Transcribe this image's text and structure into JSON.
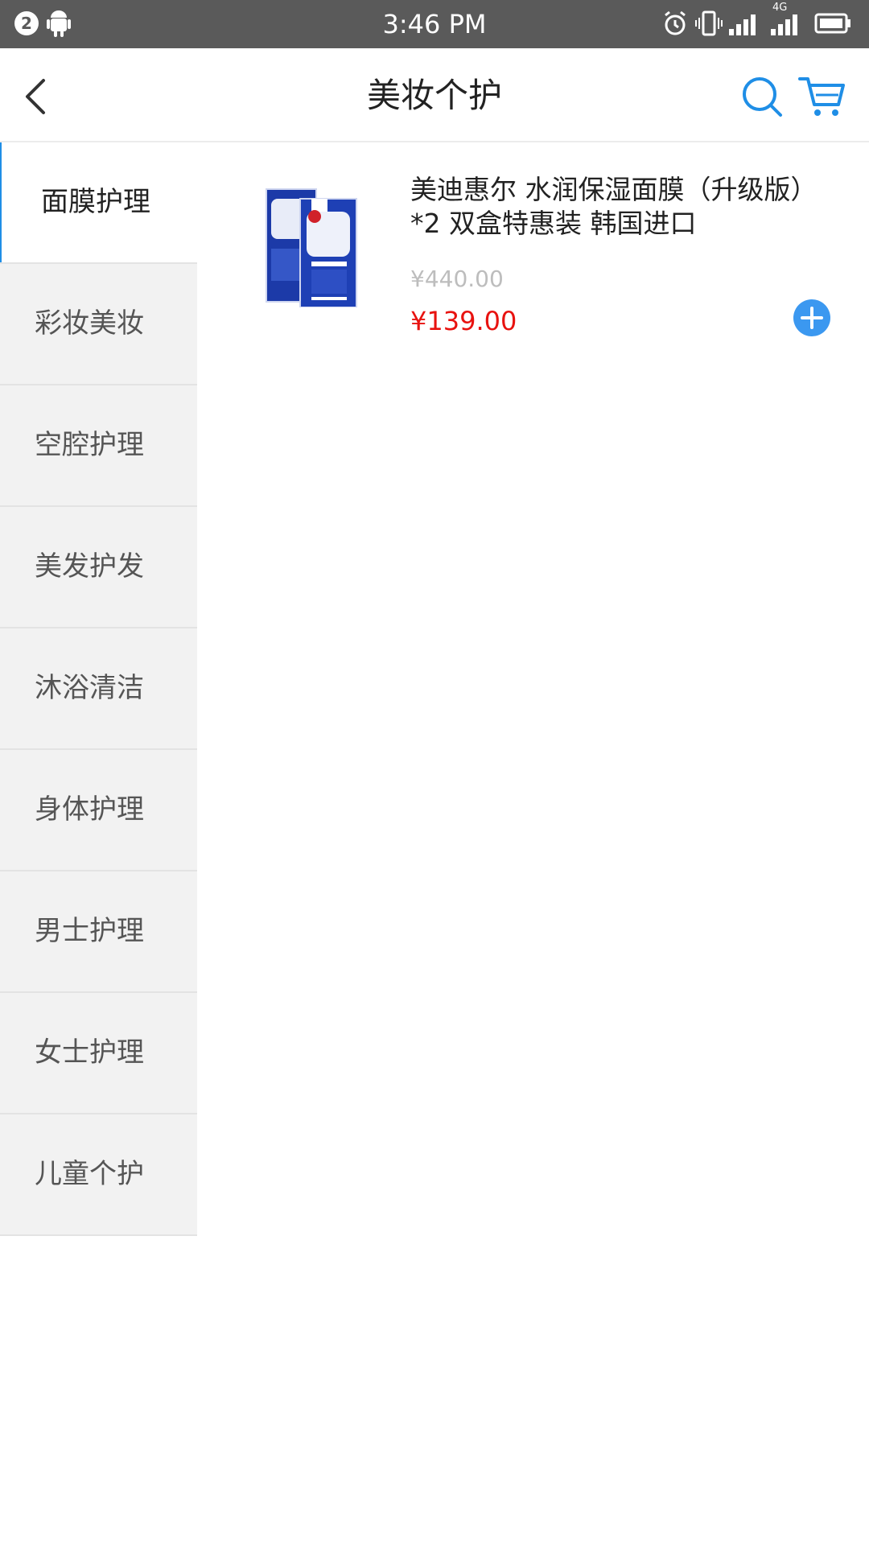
{
  "status_bar": {
    "time": "3:46 PM",
    "notification_count": "2",
    "network_label": "4G"
  },
  "header": {
    "title": "美妆个护"
  },
  "colors": {
    "accent": "#1f8ee6",
    "price": "#e8120f",
    "sidebar_bg": "#f2f2f2"
  },
  "sidebar": {
    "items": [
      {
        "label": "面膜护理",
        "active": true
      },
      {
        "label": "彩妆美妆",
        "active": false
      },
      {
        "label": "空腔护理",
        "active": false
      },
      {
        "label": "美发护发",
        "active": false
      },
      {
        "label": "沐浴清洁",
        "active": false
      },
      {
        "label": "身体护理",
        "active": false
      },
      {
        "label": "男士护理",
        "active": false
      },
      {
        "label": "女士护理",
        "active": false
      },
      {
        "label": "儿童个护",
        "active": false
      }
    ]
  },
  "products": [
    {
      "name": "美迪惠尔 水润保湿面膜（升级版）*2 双盒特惠装 韩国进口",
      "original_price": "¥440.00",
      "price": "¥139.00"
    }
  ]
}
